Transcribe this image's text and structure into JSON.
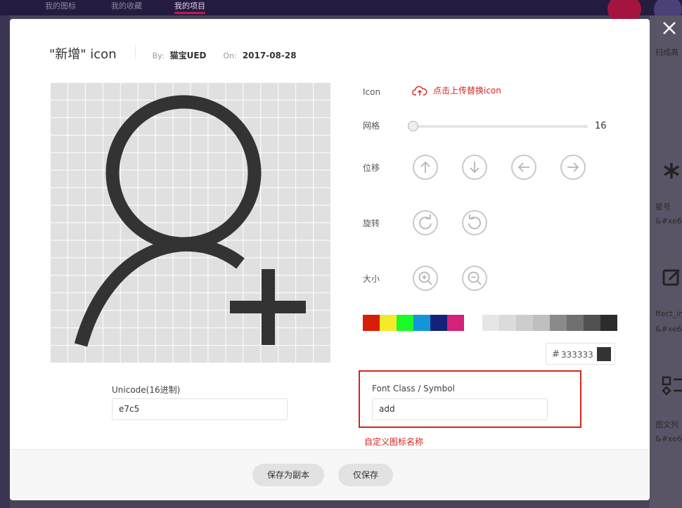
{
  "background": {
    "tabs": [
      "我的图标",
      "我的收藏",
      "我的项目"
    ],
    "side_items": [
      {
        "icon": "asterisk-icon",
        "name": "星号",
        "code": "&#xe6"
      },
      {
        "icon": "edit-icon",
        "name": "ffect_inf",
        "code": "&#xe6"
      },
      {
        "icon": "grid-layout-icon",
        "name": "图文列",
        "code": "&#xe6"
      }
    ],
    "right_top_text": "扫成高"
  },
  "modal": {
    "title": "\"新增\" icon",
    "by_label": "By:",
    "author": "猫宝UED",
    "on_label": "On:",
    "date": "2017-08-28",
    "controls": {
      "icon_label": "Icon",
      "upload_label": "点击上传替换icon",
      "grid_label": "网格",
      "grid_value": "16",
      "grid_fraction": 0.0,
      "move_label": "位移",
      "rotate_label": "旋转",
      "size_label": "大小"
    },
    "colors": {
      "swatches": [
        "#d81e06",
        "#f4ea2a",
        "#1afa29",
        "#1296db",
        "#13227a",
        "#d4237a",
        "#ffffff",
        "#e6e6e6",
        "#dbdbdb",
        "#cdcdcd",
        "#bfbfbf",
        "#8a8a8a",
        "#707070",
        "#515151",
        "#2c2c2c"
      ],
      "hash": "#",
      "current_hex": "333333",
      "current_color": "#333333"
    },
    "unicode": {
      "label": "Unicode(16进制)",
      "value": "e7c5"
    },
    "font_class": {
      "label": "Font Class / Symbol",
      "value": "add"
    },
    "annotation": "自定义图标名称",
    "buttons": {
      "save_copy": "保存为副本",
      "save_only": "仅保存"
    }
  }
}
